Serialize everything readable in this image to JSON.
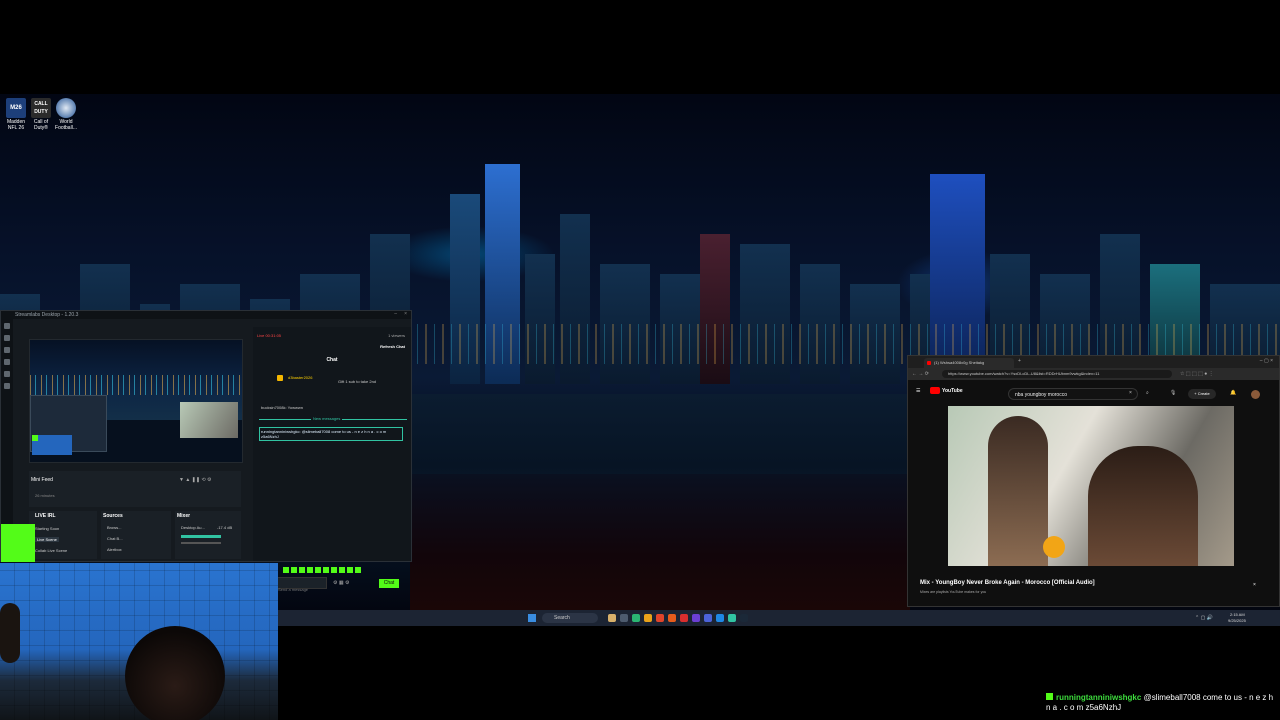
{
  "desktop": {
    "icons": [
      {
        "label": "Madden NFL 26",
        "badge": "M26",
        "color": "#1d3f7a"
      },
      {
        "label": "Call of Duty®",
        "badge": "CALL DUTY",
        "color": "#2b2b2b"
      },
      {
        "label": "World Football...",
        "badge": "",
        "color": "#5a7fb0"
      }
    ]
  },
  "streamlabs": {
    "title": "Streamlabs Desktop - 1.20.3",
    "live_status": "Live 00:31:05",
    "viewers": "1 viewers",
    "refresh_chat": "Refresh Chat",
    "mini_feed": {
      "title": "Mini Feed",
      "filter": "26 minutes"
    },
    "scenes": {
      "title": "LIVE IRL",
      "items": [
        "Starting Soon",
        "Live Scene",
        "Collab Live Scene"
      ]
    },
    "sources": {
      "title": "Sources",
      "items": [
        "Brows...",
        "Chat B...",
        "Alertbox"
      ]
    },
    "mixer": {
      "title": "Mixer",
      "items": [
        {
          "name": "Desktop Au...",
          "level": "-17.4 dB"
        }
      ]
    },
    "chat": {
      "header": "Chat",
      "gift_user": "d3baster2026",
      "gift_text": "Gift 1 sub to take 2nd",
      "message1": "bucksin7008k: Yowwwn",
      "new_messages": "New messages",
      "message2": "runningtanniniwshgkc: @slimeball7008 come to us - n e z h n a . c o m z5a6NzhJ",
      "send_placeholder": "Send a message",
      "chat_button": "Chat"
    }
  },
  "browser": {
    "tab_title": "(1) Wshsa4008x0g Sheitakg",
    "url": "https://www.youtube.com/watch?v=YsxDl-cDL-U8&list=RDDrHUbnm9vwkg&index=11",
    "search_query": "nba youngboy morocco",
    "create_label": "Create",
    "youtube_label": "YouTube",
    "mix_title": "Mix - YoungBoy Never Broke Again - Morocco [Official Audio]",
    "mix_subtitle": "Mixes are playlists YouTube makes for you"
  },
  "taskbar": {
    "search_label": "Search",
    "time": "2:15 AM",
    "date": "9/25/2025"
  },
  "overlay": {
    "user": "runningtanniniwshgkc",
    "message": "@slimeball7008 come to us - n e z h n a . c o m z5a6NzhJ"
  }
}
